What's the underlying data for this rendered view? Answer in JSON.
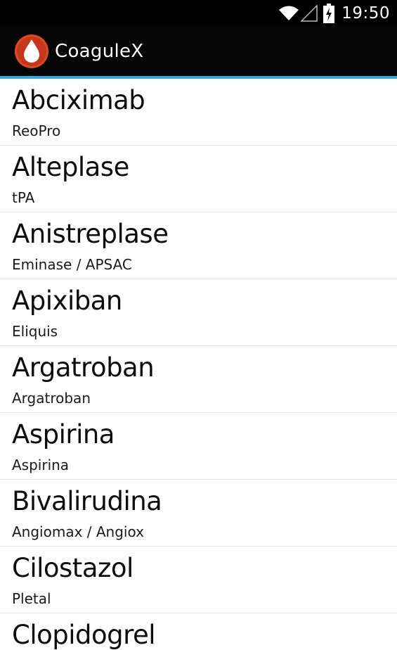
{
  "status_bar": {
    "time": "19:50",
    "icons": [
      "wifi-icon",
      "signal-icon",
      "battery-charging-icon"
    ]
  },
  "app": {
    "title": "CoaguleX",
    "icon": "blood-drop-icon",
    "brand_color": "#e2491f",
    "accent_color": "#35a8e0"
  },
  "drugs": [
    {
      "name": "Abciximab",
      "brand": "ReoPro"
    },
    {
      "name": "Alteplase",
      "brand": "tPA"
    },
    {
      "name": "Anistreplase",
      "brand": "Eminase / APSAC"
    },
    {
      "name": "Apixiban",
      "brand": "Eliquis"
    },
    {
      "name": "Argatroban",
      "brand": "Argatroban"
    },
    {
      "name": "Aspirina",
      "brand": "Aspirina"
    },
    {
      "name": "Bivalirudina",
      "brand": "Angiomax / Angiox"
    },
    {
      "name": "Cilostazol",
      "brand": "Pletal"
    },
    {
      "name": "Clopidogrel",
      "brand": ""
    }
  ]
}
